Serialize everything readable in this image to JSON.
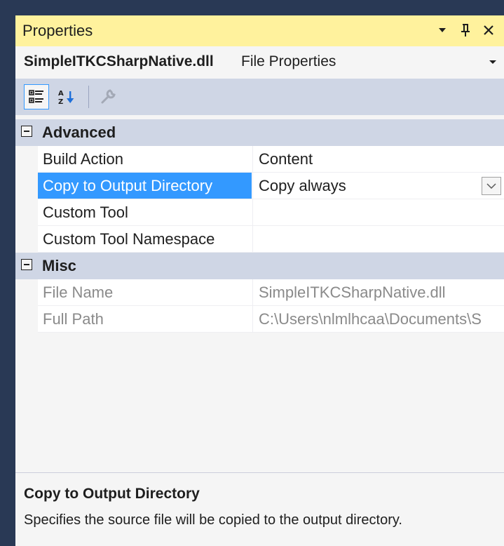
{
  "window": {
    "title": "Properties"
  },
  "object_selector": {
    "name": "SimpleITKCSharpNative.dll",
    "type": "File Properties"
  },
  "toolbar": {
    "categorized_icon": "categorized-icon",
    "alphabetical_icon": "alphabetical-sort-icon",
    "property_pages_icon": "wrench-icon"
  },
  "categories": [
    {
      "name": "Advanced",
      "properties": [
        {
          "name": "Build Action",
          "value": "Content"
        },
        {
          "name": "Copy to Output Directory",
          "value": "Copy always"
        },
        {
          "name": "Custom Tool",
          "value": ""
        },
        {
          "name": "Custom Tool Namespace",
          "value": ""
        }
      ]
    },
    {
      "name": "Misc",
      "properties": [
        {
          "name": "File Name",
          "value": "SimpleITKCSharpNative.dll"
        },
        {
          "name": "Full Path",
          "value": "C:\\Users\\nlmlhcaa\\Documents\\S"
        }
      ]
    }
  ],
  "description": {
    "title": "Copy to Output Directory",
    "text": "Specifies the source file will be copied to the output directory."
  },
  "colors": {
    "title_bar": "#fff29d",
    "selection": "#3399ff",
    "category_band": "#cfd6e5",
    "frame": "#293955"
  }
}
